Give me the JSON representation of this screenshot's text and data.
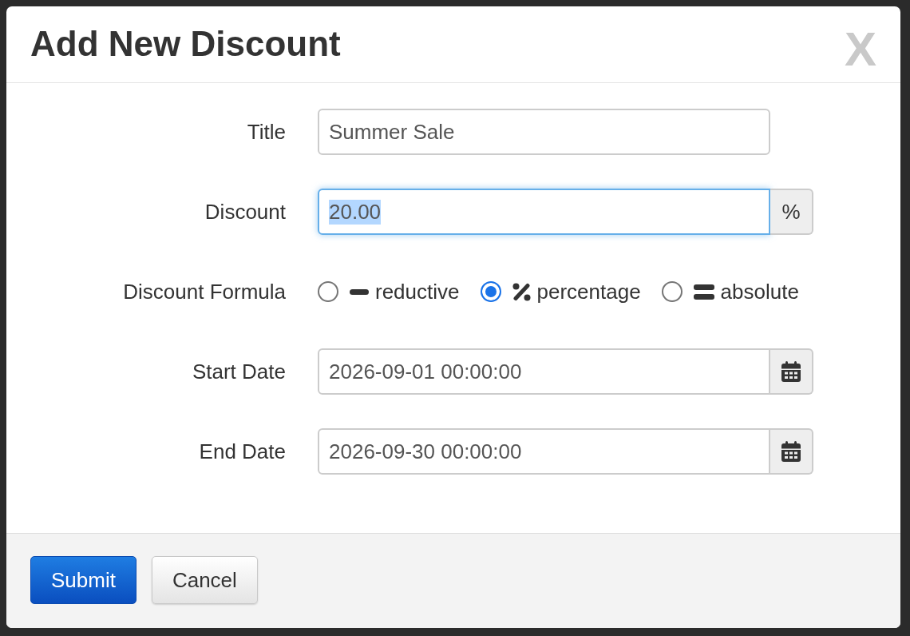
{
  "dialog": {
    "title": "Add New Discount",
    "close_label": "X"
  },
  "form": {
    "fields": [
      {
        "kind": "text",
        "label": "Title",
        "value": "Summer Sale",
        "focused": false,
        "text_selected": false
      },
      {
        "kind": "unit",
        "label": "Discount",
        "value": "20.00",
        "unit": "%",
        "focused": true,
        "text_selected": true
      },
      {
        "kind": "radio",
        "label": "Discount Formula",
        "options": [
          {
            "label": "reductive",
            "selected": false
          },
          {
            "label": "percentage",
            "selected": true
          },
          {
            "label": "absolute",
            "selected": false
          }
        ]
      },
      {
        "kind": "date",
        "label": "Start Date",
        "value": "2026-09-01 00:00:00",
        "focused": false,
        "text_selected": false
      },
      {
        "kind": "date",
        "label": "End Date",
        "value": "2026-09-30 00:00:00",
        "focused": false,
        "text_selected": false
      }
    ]
  },
  "footer": {
    "buttons": [
      {
        "kind": "primary",
        "label": "Submit"
      },
      {
        "kind": "default",
        "label": "Cancel"
      }
    ]
  }
}
